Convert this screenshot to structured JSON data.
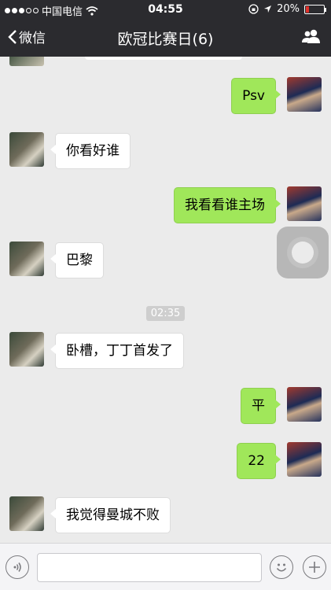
{
  "status_bar": {
    "carrier": "中国电信",
    "time": "04:55",
    "battery": "20%",
    "battery_level": 0.2,
    "battery_color": "#e0302a"
  },
  "nav": {
    "back_label": "微信",
    "title": "欧冠比赛日(6)"
  },
  "messages": [
    {
      "sender": "self",
      "text": "Psv"
    },
    {
      "sender": "other",
      "text": "你看好谁"
    },
    {
      "sender": "self",
      "text": "我看看谁主场"
    },
    {
      "sender": "other",
      "text": "巴黎"
    },
    {
      "type": "timestamp",
      "text": "02:35"
    },
    {
      "sender": "other",
      "text": "卧槽，丁丁首发了"
    },
    {
      "sender": "self",
      "text": "平"
    },
    {
      "sender": "self",
      "text": "22"
    },
    {
      "sender": "other",
      "text": "我觉得曼城不败"
    }
  ],
  "colors": {
    "nav_background": "#2b2b2f",
    "self_bubble": "#a0e75a",
    "other_bubble": "#ffffff",
    "chat_background": "#ebebeb"
  },
  "input_bar": {
    "value": "",
    "voice_icon": "voice-icon",
    "emoji_icon": "emoji-icon",
    "plus_icon": "plus-icon"
  }
}
